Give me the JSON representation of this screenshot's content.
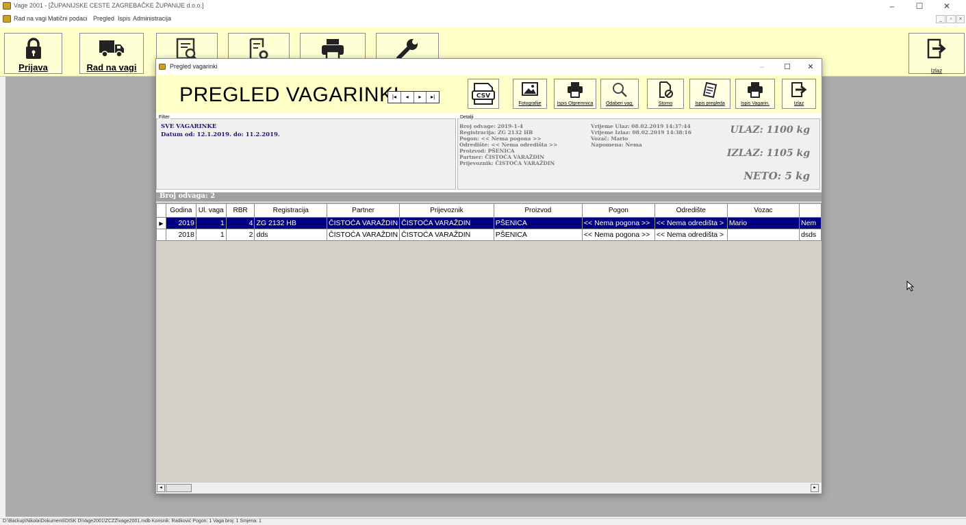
{
  "window": {
    "title": "Vage 2001 - [ŽUPANIJSKE CESTE ZAGREBAČKE ŽUPANIJE d.o.o.]",
    "controls": [
      "–",
      "☐",
      "✕"
    ]
  },
  "menu": {
    "items": [
      "Rad na vagi",
      "Matični podaci",
      "Pregled",
      "Ispis",
      "Administracija"
    ],
    "mdi_controls": [
      "_",
      "▫",
      "×"
    ]
  },
  "toolbar": {
    "buttons": [
      {
        "label": "Prijava",
        "icon": "lock-icon"
      },
      {
        "label": "Rad na vagi",
        "icon": "truck-icon"
      },
      {
        "label": "",
        "icon": "search-document-icon"
      },
      {
        "label": "",
        "icon": "document-settings-icon"
      },
      {
        "label": "",
        "icon": "printer-icon"
      },
      {
        "label": "",
        "icon": "wrench-icon"
      }
    ],
    "exit_label": "Izlaz"
  },
  "dialog": {
    "title": "Pregled vagarinki",
    "controls": [
      "–",
      "☐",
      "✕"
    ],
    "heading": "PREGLED VAGARINKI",
    "nav": [
      "|◂",
      "◂",
      "▸",
      "▸|"
    ],
    "buttons": [
      {
        "label": "",
        "icon": "csv-icon"
      },
      {
        "label": "Fotografije",
        "icon": "image-icon"
      },
      {
        "label": "Ispis Otpremnica",
        "icon": "printer-icon"
      },
      {
        "label": "Odaberi vag.",
        "icon": "magnifier-icon"
      },
      {
        "label": "Storno",
        "icon": "cancel-document-icon"
      },
      {
        "label": "Ispis pregleda",
        "icon": "notes-icon"
      },
      {
        "label": "Ispis Vagarin.",
        "icon": "printer-icon"
      },
      {
        "label": "Izlaz",
        "icon": "exit-icon"
      }
    ],
    "filter": {
      "legend": "Filter",
      "line1": "SVE VAGARINKE",
      "line2": "Datum od: 12.1.2019. do: 11.2.2019."
    },
    "details": {
      "legend": "Detalji",
      "left": [
        "Broj odvage: 2019-1-4",
        "Registracija: ZG 2132 HB",
        "Pogon: << Nema pogona >>",
        "Odredište: << Nema odredišta >>",
        "Proizvod: PŠENICA",
        "Partner: ČISTOĆA VARAŽDIN",
        "Prijevoznik: ČISTOĆA VARAŽDIN"
      ],
      "right": [
        "Vrijeme Ulaz: 08.02.2019  14:37:44",
        "Vrijeme Izlaz: 08.02.2019  14:38:16",
        "Vozač: Mario",
        "Napomena: Nema"
      ],
      "ulaz": "ULAZ: 1100 kg",
      "izlaz": "IZLAZ: 1105 kg",
      "neto": "NETO: 5 kg"
    },
    "count_label": "Broj odvaga: 2",
    "grid": {
      "columns": [
        "Godina",
        "Ul. vaga",
        "RBR",
        "Registracija",
        "Partner",
        "Prijevoznik",
        "Proizvod",
        "Pogon",
        "Odredište",
        "Vozac",
        ""
      ],
      "rows": [
        {
          "selected": true,
          "cells": [
            "2019",
            "1",
            "4",
            "ZG 2132 HB",
            "ČISTOĆA VARAŽDIN",
            "ČISTOĆA VARAŽDIN",
            "PŠENICA",
            "<< Nema pogona >>",
            "<< Nema odredišta >",
            "Mario",
            "Nem"
          ]
        },
        {
          "selected": false,
          "cells": [
            "2018",
            "1",
            "2",
            "dds",
            "ČISTOĆA VARAŽDIN",
            "ČISTOĆA VARAŽDIN",
            "PŠENICA",
            "<< Nema pogona >>",
            "<< Nema odredišta >",
            "",
            "dsds"
          ]
        }
      ]
    }
  },
  "statusbar": "D:\\Backup\\Nikola\\Dokumenti\\DISK D\\Vage2001\\ZCZZ\\vage2001.mdb  Korisnik: Radković  Pogon: 1  Vaga broj: 1  Smjena: 1",
  "colors": {
    "toolbar_bg": "#ffffc8",
    "workspace": "#ababab",
    "selection": "#000080",
    "filter_text": "#1a1a6e"
  }
}
